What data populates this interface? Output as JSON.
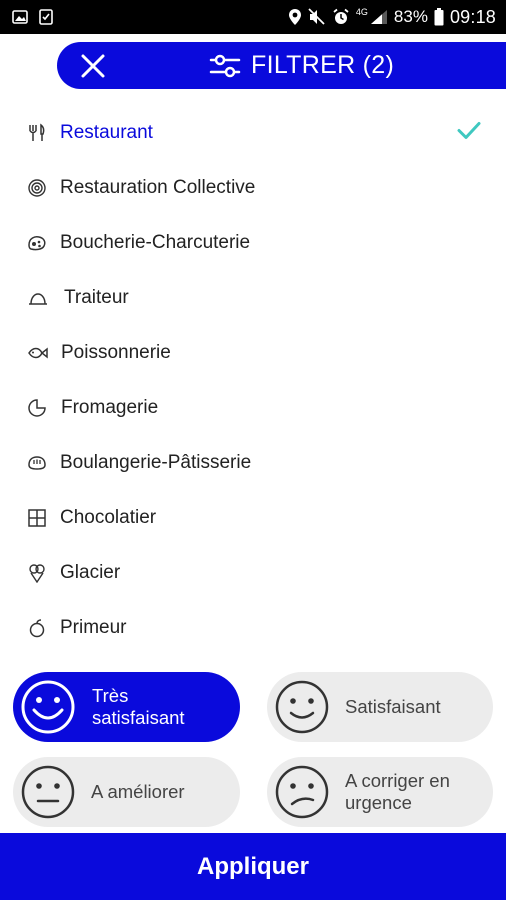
{
  "status_bar": {
    "battery": "83%",
    "time": "09:18",
    "network": "4G"
  },
  "header": {
    "title": "FILTRER (2)"
  },
  "categories": [
    {
      "label": "Restaurant",
      "icon": "fork-knife-icon",
      "selected": true
    },
    {
      "label": "Restauration Collective",
      "icon": "target-icon",
      "selected": false
    },
    {
      "label": "Boucherie-Charcuterie",
      "icon": "meat-icon",
      "selected": false
    },
    {
      "label": "Traiteur",
      "icon": "cloche-icon",
      "selected": false
    },
    {
      "label": "Poissonnerie",
      "icon": "fish-icon",
      "selected": false
    },
    {
      "label": "Fromagerie",
      "icon": "cheese-icon",
      "selected": false
    },
    {
      "label": "Boulangerie-Pâtisserie",
      "icon": "bread-icon",
      "selected": false
    },
    {
      "label": "Chocolatier",
      "icon": "chocolate-bar-icon",
      "selected": false
    },
    {
      "label": "Glacier",
      "icon": "ice-cream-icon",
      "selected": false
    },
    {
      "label": "Primeur",
      "icon": "fruit-icon",
      "selected": false
    }
  ],
  "ratings": [
    {
      "label": "Très satisfaisant",
      "selected": true
    },
    {
      "label": "Satisfaisant",
      "selected": false
    },
    {
      "label": "A améliorer",
      "selected": false
    },
    {
      "label": "A corriger en urgence",
      "selected": false
    }
  ],
  "apply_label": "Appliquer",
  "colors": {
    "accent": "#0a0adc",
    "check": "#3fc8c0",
    "chip_bg": "#ececec"
  }
}
